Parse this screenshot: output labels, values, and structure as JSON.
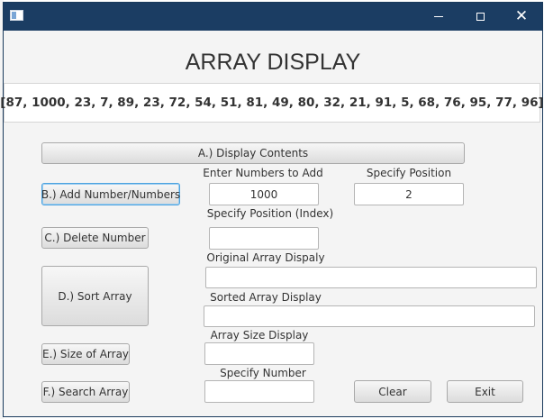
{
  "window": {
    "title": "",
    "heading": "ARRAY DISPLAY",
    "array_text": "[87, 1000, 23, 7, 89, 23, 72, 54, 51, 81, 49, 80, 32, 21, 91, 5, 68, 76, 95, 77, 96]"
  },
  "buttons": {
    "display_contents": "A.) Display Contents",
    "add_number": "B.) Add Number/Numbers",
    "delete_number": "C.) Delete Number",
    "sort_array": "D.) Sort Array",
    "size_of_array": "E.) Size of Array",
    "search_array": "F.) Search Array",
    "clear": "Clear",
    "exit": "Exit"
  },
  "labels": {
    "enter_numbers": "Enter Numbers to Add",
    "specify_position": "Specify Position",
    "specify_position_index": "Specify Position (Index)",
    "original_array_display": "Original Array Dispaly",
    "sorted_array_display": "Sorted Array Display",
    "array_size_display": "Array Size Display",
    "specify_number": "Specify Number"
  },
  "fields": {
    "numbers_to_add": "1000",
    "position": "2",
    "position_index": "",
    "original_array": "",
    "sorted_array": "",
    "array_size": "",
    "search_number": ""
  },
  "colors": {
    "titlebar": "#1b3d63",
    "focus_border": "#4da3e0",
    "window_background": "#f4f4f4"
  },
  "icons": {
    "app": "app-window-icon",
    "minimize": "minimize-icon",
    "maximize": "maximize-icon",
    "close": "close-icon"
  }
}
